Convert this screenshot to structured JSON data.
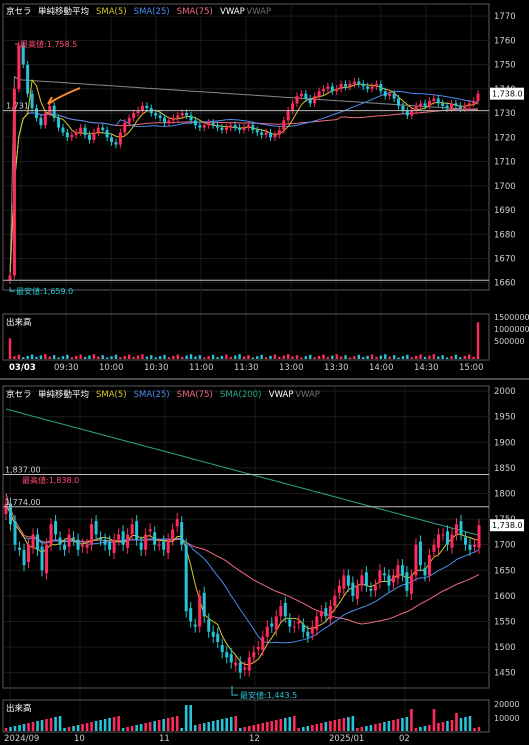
{
  "chart_data": [
    {
      "type": "candlestick",
      "name": "京セラ",
      "legend": [
        "単純移動平均",
        "SMA(5)",
        "SMA(25)",
        "SMA(75)",
        "VWAP",
        "VWAP"
      ],
      "legend_colors": [
        "#ffffff",
        "#d7c82a",
        "#4a8df0",
        "#f06a80",
        "#ffffff",
        "#6f6f6f"
      ],
      "yticks": [
        1660,
        1670,
        1680,
        1690,
        1700,
        1710,
        1720,
        1730,
        1740,
        1750,
        1760,
        1770
      ],
      "ylim": [
        1657,
        1775
      ],
      "xticks": [
        "03/03",
        "09:30",
        "10:00",
        "10:30",
        "11:00",
        "11:30",
        "13:00",
        "13:30",
        "14:00",
        "14:30",
        "15:00"
      ],
      "last_price": "1,738.0",
      "ref_line_label": "1,731",
      "high_label": "最高値:1,758.5",
      "low_label": "最安値:1,659.0",
      "close": [
        1663,
        1740,
        1758,
        1750,
        1738,
        1732,
        1728,
        1725,
        1730,
        1733,
        1728,
        1724,
        1722,
        1720,
        1721,
        1722,
        1724,
        1721,
        1719,
        1722,
        1724,
        1723,
        1720,
        1718,
        1717,
        1722,
        1726,
        1728,
        1730,
        1731,
        1733,
        1732,
        1730,
        1729,
        1728,
        1726,
        1727,
        1728,
        1729,
        1730,
        1729,
        1727,
        1725,
        1724,
        1725,
        1726,
        1725,
        1724,
        1723,
        1724,
        1725,
        1724,
        1723,
        1724,
        1725,
        1723,
        1722,
        1721,
        1722,
        1720,
        1721,
        1723,
        1727,
        1731,
        1734,
        1737,
        1738,
        1736,
        1734,
        1737,
        1739,
        1740,
        1741,
        1739,
        1740,
        1742,
        1741,
        1742,
        1743,
        1742,
        1741,
        1740,
        1741,
        1742,
        1739,
        1737,
        1738,
        1736,
        1733,
        1731,
        1729,
        1731,
        1733,
        1734,
        1733,
        1735,
        1736,
        1734,
        1733,
        1732,
        1734,
        1733,
        1732,
        1733,
        1734,
        1735,
        1738
      ],
      "vol_scale": [
        0,
        1500000
      ],
      "vol_ticks": [
        "1500000",
        "1000000",
        "500000"
      ],
      "vol_label": "出来高",
      "vol_first": 0.45,
      "vol_last": 0.8
    },
    {
      "type": "candlestick",
      "name": "京セラ",
      "legend": [
        "単純移動平均",
        "SMA(5)",
        "SMA(25)",
        "SMA(75)",
        "SMA(200)",
        "VWAP",
        "VWAP"
      ],
      "legend_colors": [
        "#ffffff",
        "#d7c82a",
        "#4a8df0",
        "#f06a80",
        "#29a98b",
        "#ffffff",
        "#6f6f6f"
      ],
      "yticks": [
        1450,
        1500,
        1550,
        1600,
        1650,
        1700,
        1750,
        1800,
        1850,
        1900,
        1950,
        2000
      ],
      "ylim": [
        1420,
        2010
      ],
      "xticks": [
        "2024/09",
        "10",
        "11",
        "12",
        "2025/01",
        "02"
      ],
      "last_price": "1,738.0",
      "ref_line_labels": [
        "1,837.00",
        "最高値:1,838.0",
        "1,774.00"
      ],
      "low_label": "最安値:1,443.5",
      "close": [
        1780,
        1740,
        1700,
        1690,
        1660,
        1700,
        1720,
        1690,
        1650,
        1700,
        1740,
        1720,
        1700,
        1690,
        1720,
        1710,
        1690,
        1700,
        1700,
        1740,
        1720,
        1710,
        1700,
        1690,
        1710,
        1720,
        1700,
        1720,
        1740,
        1710,
        1690,
        1720,
        1730,
        1700,
        1700,
        1690,
        1710,
        1730,
        1750,
        1700,
        1570,
        1550,
        1540,
        1600,
        1560,
        1530,
        1520,
        1510,
        1490,
        1480,
        1470,
        1470,
        1450,
        1460,
        1480,
        1490,
        1500,
        1520,
        1540,
        1540,
        1560,
        1580,
        1560,
        1540,
        1540,
        1550,
        1530,
        1520,
        1540,
        1560,
        1570,
        1560,
        1580,
        1600,
        1620,
        1640,
        1620,
        1600,
        1620,
        1640,
        1620,
        1610,
        1620,
        1650,
        1640,
        1620,
        1640,
        1660,
        1640,
        1610,
        1640,
        1700,
        1660,
        1640,
        1680,
        1700,
        1720,
        1720,
        1700,
        1720,
        1740,
        1720,
        1700,
        1690,
        1700,
        1738
      ],
      "vol_label": "出来高",
      "vol_ticks": [
        "20000",
        "10000"
      ]
    }
  ]
}
